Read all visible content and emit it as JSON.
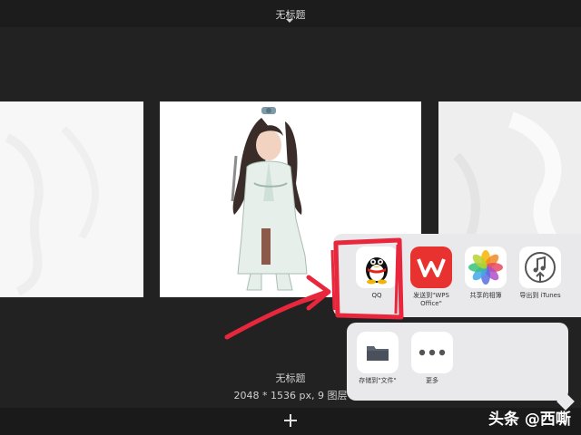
{
  "header": {
    "title": "无标题"
  },
  "document": {
    "name": "无标题",
    "info": "2048 * 1536 px, 9 图层"
  },
  "share_sheet": {
    "apps": [
      {
        "label": "QQ",
        "icon": "qq-penguin-icon"
      },
      {
        "label": "发送到\"WPS Office\"",
        "icon": "wps-office-icon"
      },
      {
        "label": "共享的相簿",
        "icon": "photos-icon"
      },
      {
        "label": "导出到 iTunes",
        "icon": "itunes-export-icon"
      }
    ],
    "actions": [
      {
        "label": "存储到\"文件\"",
        "icon": "folder-icon"
      },
      {
        "label": "更多",
        "icon": "more-icon"
      }
    ]
  },
  "watermark": {
    "text": "头条 @西嘶"
  },
  "colors": {
    "background": "#222222",
    "sheet": "#e9e9ec",
    "wps_red": "#e8322f",
    "annotation": "#e8263c"
  }
}
